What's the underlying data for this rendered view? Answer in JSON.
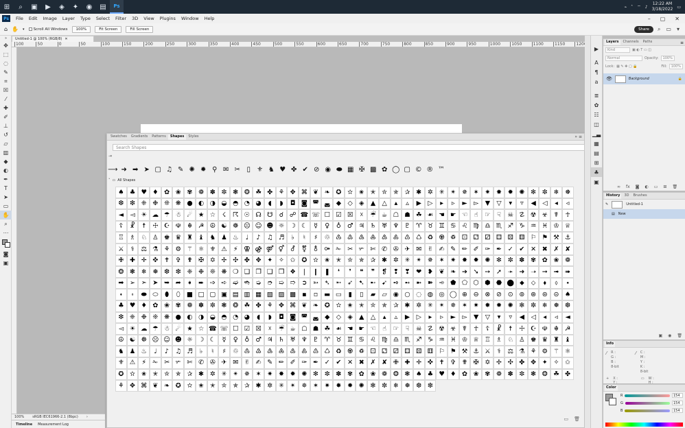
{
  "taskbar": {
    "icons": [
      "windows-icon",
      "search-icon",
      "task-view-icon",
      "media-player-icon",
      "vm-icon",
      "game-icon",
      "firefox-icon",
      "file-explorer-icon",
      "photoshop-icon"
    ],
    "clock_time": "12:22 AM",
    "clock_date": "3/18/2022"
  },
  "menubar": {
    "app_badge": "Ps",
    "items": [
      "File",
      "Edit",
      "Image",
      "Layer",
      "Type",
      "Select",
      "Filter",
      "3D",
      "View",
      "Plugins",
      "Window",
      "Help"
    ]
  },
  "options": {
    "scroll_all": "Scroll All Windows",
    "zoom": "100%",
    "fit": "Fit Screen",
    "fill": "Fill Screen",
    "share": "Share"
  },
  "document": {
    "tab_title": "Untitled-1 @ 100% (RGB/8)",
    "ruler_ticks": [
      "100",
      "50",
      "0",
      "50",
      "100",
      "150",
      "200",
      "250",
      "300",
      "350",
      "400",
      "450",
      "500",
      "550",
      "600",
      "650",
      "700",
      "750",
      "800",
      "850",
      "900",
      "950",
      "1000",
      "1050",
      "1100",
      "1150",
      "1200"
    ],
    "status_zoom": "100%",
    "status_profile": "sRGB IEC61966-2.1 (8bpc)"
  },
  "bottom_tabs": [
    "Timeline",
    "Measurement Log"
  ],
  "shapes_panel": {
    "tabs": [
      "Swatches",
      "Gradients",
      "Patterns",
      "Shapes",
      "Styles"
    ],
    "active_tab": "Shapes",
    "search_placeholder": "Search Shapes",
    "group_label": "All Shapes",
    "recent": [
      "⟶",
      "➜",
      "➡",
      "➤",
      "▢",
      "♫",
      "✎",
      "✺",
      "✹",
      "⚲",
      "✉",
      "✂",
      "▯",
      "⚜",
      "♞",
      "♥",
      "✤",
      "✔",
      "⊘",
      "◉",
      "⬬",
      "▦",
      "✠",
      "▩",
      "✿",
      "◯",
      "▢",
      "©",
      "®",
      "™"
    ],
    "shape_glyphs": "♠♣♥♦✿❀✾❁✽✼❃❂☘✤⚘✥⌘❦❧✪✫✬✭✮✯✰✱✲✳✴✵✶✷✸✹✺✻✼❄❅❆❇❈❉❊❋●◐◑◒◓◔◕◖◗◘◙◚◛◆◇◈▲△▴▵▶▷▸▹►▻▼▽▾▿◀◁◂◃◄◅☀☁☂☃☄★☆☇☈☉☊☋☌☍☎☏☐☑☒☓☔☕☖☗☘☙☚☛☜☝☞☟☠☡☢☣☤☥☦☧☨☩☪☫☬☭☮☯☸☹☺☻☼☽☾☿♀♁♂♃♄♅♆♇♈♉♊♋♌♍♎♏♐♑♒♓♔♕♖♗♘♙♚♛♜♝♞♟♨♩♪♫♬♭♮♯♲♳♴♵♶♷♸♹♺♻♼♽⚀⚁⚂⚃⚄⚅⚐⚑⚒⚓⚔⚕⚖⚗⚘⚙⚚⚛⚜⚠⚡⚢⚣⚤⚥⚦⚧⚨⚩✁✂✃✄✆✇✈✉✌✍✎✏✐✑✒✓✔✕✖✗✘✙✚✛✜✝✞✟✠✡✢✣✤✥✦✧✩✪✫✬✭✮✯✰✱✲✳✴✵✶✷✸✹✺✻✼✽✾✿❀❁❂❃❄❅❆❇❈❉❊❋❍❏❐❑❒❖❘❙❚❛❜❝❞❡❢❣❤❥❦❧➔➘➙➚➛➜➝➞➟➠➡➢➣➤➥➦➧➨➩➪➫➬➭➮➯➱➲➳➴➵➶➷➸➹➺➻➼➽➾⬟⬠⬡⬢⬣⬤⬥⬦⬧⬨⬩⬪⬫⬬⬭⬮⬯■□▢▣▤▥▦▧▨▩▪▫▬▭▮▯▰▱◉○◌◍◎◯⊕⊖⊗⊘⊙⊚⊛⊜⊝♠♣♥♦✿❀✾❁✽✼❃❂☘✤⚘✥⌘❦❧✪✫✬✭✮✯✰✱✲✳✴✵✶✷✸✹✺✻✼❄❅❆❇❈❉❊❋●◐◑◒◓◔◕◖◗◘◙◚◛◆◇◈▲△▴▵▶▷▸▹►▻▼▽▾▿◀◁◂◃◄◅☀☁☂☃☄★☆☎☏☐☑☒☓☔☕☖☗☘☙☚☛☜☝☞☟☠☡☢☣☤☥☦☧☨☩☪☫☬☭☮☯☸☹☺☻☼☽☾☿♀♁♂♃♄♅♆♇♈♉♊♋♌♍♎♏♐♑♒♓♔♕♖♗♘♙♚♛♜♝♞♟♨♩♪♫♬♭♮♯♲♳♴♵♶♷♸♹♺♻♼♽⚀⚁⚂⚃⚄⚅⚐⚑⚒⚓⚔⚕⚖⚗⚘⚙⚚⚛⚜⚠⚡✁✂✃✄✆✇✈✉✌✍✎✏✐✑✒✓✔✕✖✗✘✙✚✛✜✝✞✟✠✡✢✣✤✥✦✧✩✪✫✬✭✮✯✰✱✲✳✴✵✶✷✸✹✺✻✼✽✾✿❀❁❂❃"
  },
  "layers_panel": {
    "tabs": [
      "Layers",
      "Channels",
      "Paths"
    ],
    "kind": "Kind",
    "blend": "Normal",
    "opacity_label": "Opacity:",
    "opacity": "100%",
    "lock_label": "Lock:",
    "fill_label": "Fill:",
    "fill": "100%",
    "layer_name": "Background"
  },
  "history_panel": {
    "tabs": [
      "History",
      "3D",
      "Brushes"
    ],
    "snapshot": "Untitled-1",
    "state": "New"
  },
  "info_panel": {
    "title": "Info",
    "left_labels": [
      "R :",
      "G :",
      "B :"
    ],
    "right_labels": [
      "C :",
      "M :",
      "Y :",
      "K :"
    ],
    "bit_left": "8-bit",
    "bit_right": "8-bit",
    "x": "X :",
    "y": "Y :",
    "w": "W :",
    "h": "H :"
  },
  "color_panel": {
    "title": "Color",
    "channels": [
      {
        "label": "R",
        "value": "154"
      },
      {
        "label": "G",
        "value": "154"
      },
      {
        "label": "B",
        "value": "154"
      }
    ]
  }
}
